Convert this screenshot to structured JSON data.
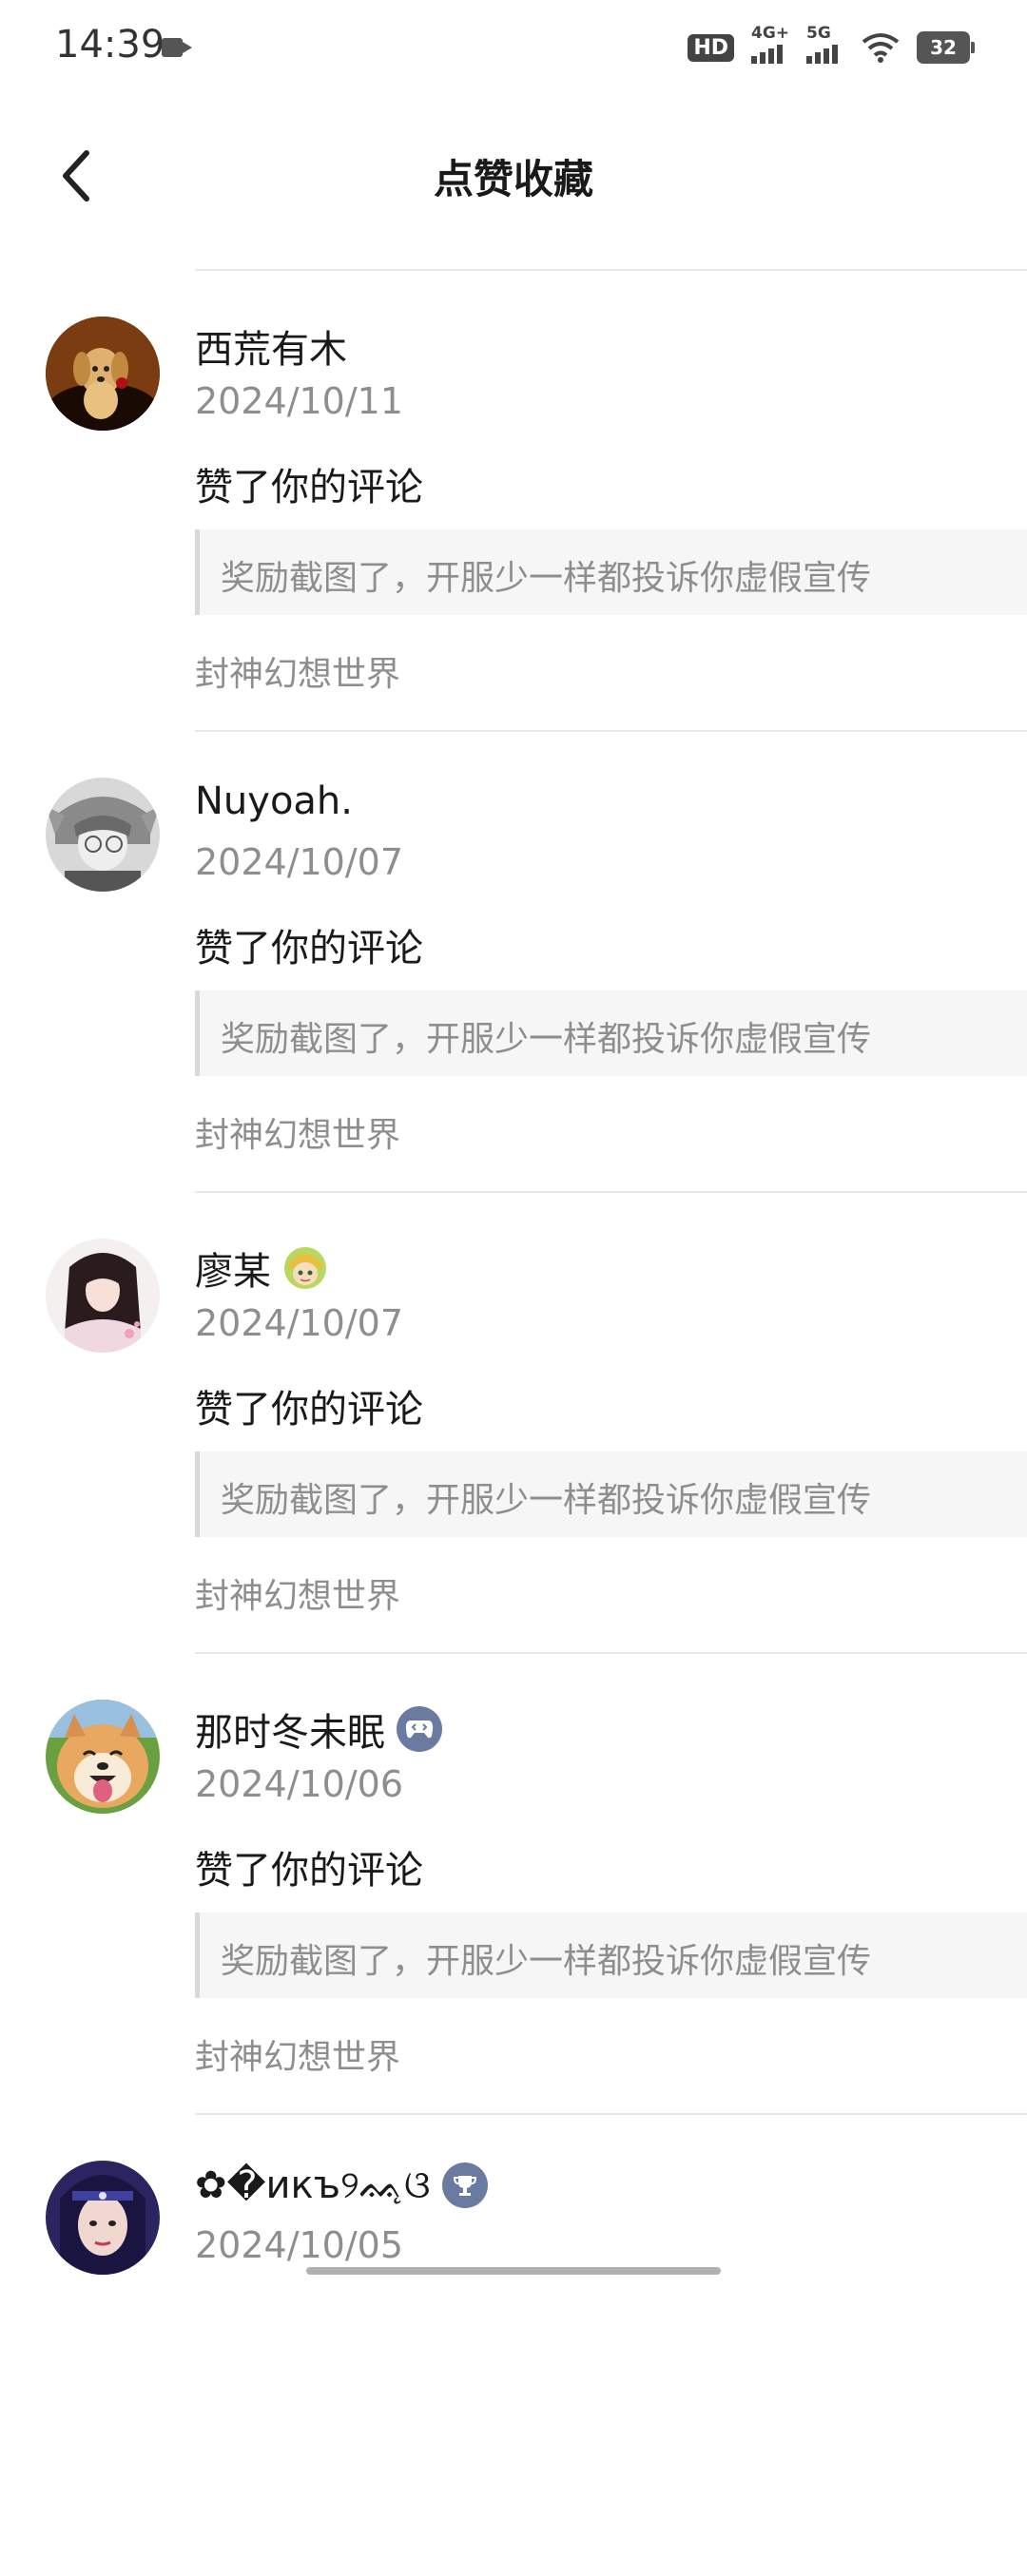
{
  "status_bar": {
    "time": "14:39",
    "hd_label": "HD",
    "signal1_label": "4G+",
    "signal2_label": "5G",
    "battery": "32"
  },
  "header": {
    "title": "点赞收藏"
  },
  "items": [
    {
      "username": "西荒有木",
      "date": "2024/10/11",
      "action": "赞了你的评论",
      "quote": "奖励截图了，开服少一样都投诉你虚假宣传",
      "source": "封神幻想世界",
      "avatar": "dog-avatar"
    },
    {
      "username": "Nuyoah.",
      "date": "2024/10/07",
      "action": "赞了你的评论",
      "quote": "奖励截图了，开服少一样都投诉你虚假宣传",
      "source": "封神幻想世界",
      "avatar": "anime-boy-avatar"
    },
    {
      "username": "廖某",
      "date": "2024/10/07",
      "action": "赞了你的评论",
      "quote": "奖励截图了，开服少一样都投诉你虚假宣传",
      "source": "封神幻想世界",
      "avatar": "anime-girl-avatar",
      "badge": "character-badge-icon"
    },
    {
      "username": "那时冬未眠",
      "date": "2024/10/06",
      "action": "赞了你的评论",
      "quote": "奖励截图了，开服少一样都投诉你虚假宣传",
      "source": "封神幻想世界",
      "avatar": "shiba-avatar",
      "badge": "gamepad-badge-icon"
    },
    {
      "username": "✿�икъ୨ᨐ̨ଓ",
      "date": "2024/10/05",
      "avatar": "portrait-avatar",
      "badge": "trophy-badge-icon"
    }
  ]
}
